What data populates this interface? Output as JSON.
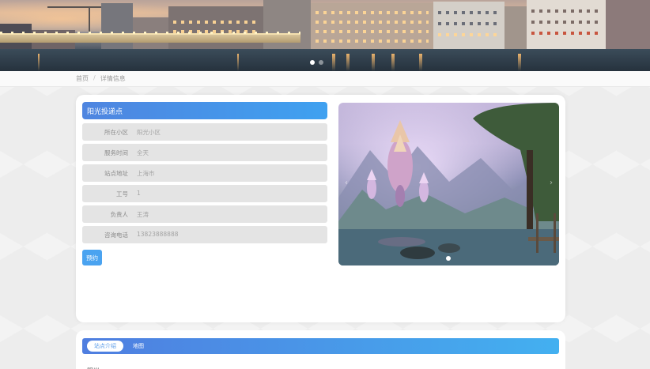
{
  "banner": {
    "slides": 2,
    "active_slide": 1
  },
  "breadcrumb": {
    "home": "首页",
    "separator": "/",
    "current": "详情信息"
  },
  "detail": {
    "title": "阳光投递点",
    "fields": [
      {
        "label": "所在小区",
        "value": "阳光小区"
      },
      {
        "label": "服务时间",
        "value": "全天"
      },
      {
        "label": "站点地址",
        "value": "上海市"
      },
      {
        "label": "工号",
        "value": "1"
      },
      {
        "label": "负责人",
        "value": "王涛"
      },
      {
        "label": "咨询电话",
        "value": "13823888888"
      }
    ],
    "reserve_button": "预约"
  },
  "carousel": {
    "slides": 1,
    "active_slide": 1,
    "prev_icon": "‹",
    "next_icon": "›"
  },
  "tabs": {
    "items": [
      {
        "label": "站点介绍",
        "active": true
      },
      {
        "label": "地图",
        "active": false
      }
    ],
    "content_preview": "阳光"
  },
  "colors": {
    "accent_start": "#4f85e0",
    "accent_end": "#3fa1f0",
    "button": "#4aa3f0"
  }
}
